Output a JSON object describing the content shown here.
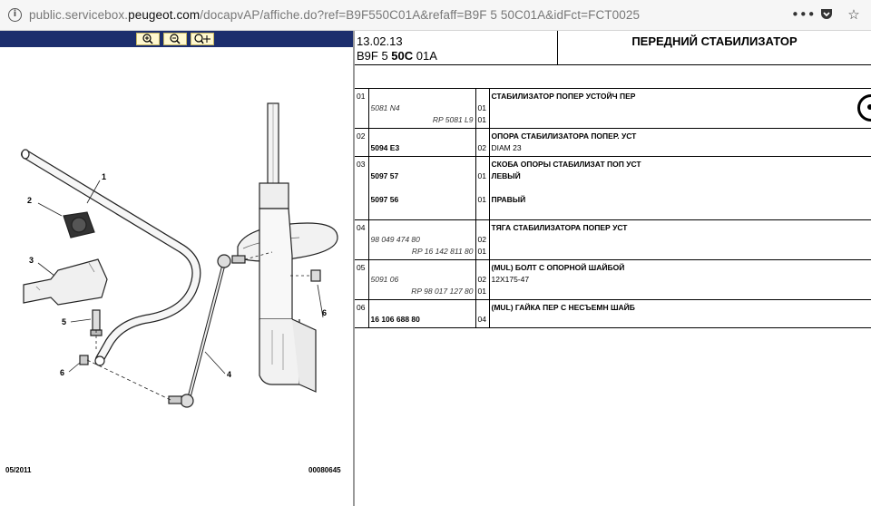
{
  "browser": {
    "url_prefix": "public.servicebox.",
    "url_domain": "peugeot.com",
    "url_suffix": "/docapvAP/affiche.do?ref=B9F550C01A&refaff=B9F 5 50C01A&idFct=FCT0025",
    "icons": [
      "info-icon",
      "more-icon",
      "pocket-icon",
      "star-icon"
    ]
  },
  "diagram": {
    "toolbar_buttons": [
      "zoom-in-icon",
      "zoom-out-icon",
      "zoom-pan-icon"
    ],
    "callouts": [
      "1",
      "2",
      "3",
      "4",
      "5",
      "6",
      "6"
    ],
    "footer_date": "05/2011",
    "footer_code": "00080645"
  },
  "header": {
    "date": "13.02.13",
    "code_prefix": "B9F 5 ",
    "code_bold": "50C",
    "code_suffix": " 01A",
    "title": "ПЕРЕДНИЙ СТАБИЛИЗАТОР"
  },
  "rows": [
    {
      "num": "01",
      "lines": [
        {
          "pn": "",
          "pn_style": "",
          "qty": "",
          "desc": "СТАБИЛИЗАТОР ПОПЕР УСТОЙЧ ПЕР",
          "desc_style": "b"
        },
        {
          "pn": "5081 N4",
          "pn_style": "it",
          "qty": "01",
          "desc": "",
          "desc_style": ""
        },
        {
          "pn": "RP 5081 L9",
          "pn_style": "it r",
          "qty": "01",
          "desc": "",
          "desc_style": ""
        }
      ]
    },
    {
      "num": "02",
      "lines": [
        {
          "pn": "",
          "pn_style": "",
          "qty": "",
          "desc": "ОПОРА СТАБИЛИЗАТОРА ПОПЕР. УСТ",
          "desc_style": "b"
        },
        {
          "pn": "5094 E3",
          "pn_style": "b",
          "qty": "02",
          "desc": "DIAM 23",
          "desc_style": ""
        }
      ]
    },
    {
      "num": "03",
      "lines": [
        {
          "pn": "",
          "pn_style": "",
          "qty": "",
          "desc": "СКОБА ОПОРЫ СТАБИЛИЗАТ ПОП УСТ",
          "desc_style": "b"
        },
        {
          "pn": "5097 57",
          "pn_style": "b",
          "qty": "01",
          "desc": "ЛЕВЫЙ",
          "desc_style": "b"
        },
        {
          "pn": "",
          "pn_style": "",
          "qty": "",
          "desc": "",
          "desc_style": ""
        },
        {
          "pn": "5097 56",
          "pn_style": "b",
          "qty": "01",
          "desc": "ПРАВЫЙ",
          "desc_style": "b"
        },
        {
          "pn": "",
          "pn_style": "",
          "qty": "",
          "desc": "",
          "desc_style": ""
        }
      ]
    },
    {
      "num": "04",
      "lines": [
        {
          "pn": "",
          "pn_style": "",
          "qty": "",
          "desc": "ТЯГА СТАБИЛИЗАТОРА ПОПЕР УСТ",
          "desc_style": "b"
        },
        {
          "pn": "98 049 474 80",
          "pn_style": "it",
          "qty": "02",
          "desc": "",
          "desc_style": ""
        },
        {
          "pn": "RP 16 142 811 80",
          "pn_style": "it r",
          "qty": "01",
          "desc": "",
          "desc_style": ""
        }
      ]
    },
    {
      "num": "05",
      "lines": [
        {
          "pn": "",
          "pn_style": "",
          "qty": "",
          "desc": "(MUL) БОЛТ С ОПОРНОЙ ШАЙБОЙ",
          "desc_style": "b"
        },
        {
          "pn": "5091 06",
          "pn_style": "it",
          "qty": "02",
          "desc": "12X175-47",
          "desc_style": ""
        },
        {
          "pn": "RP 98 017 127 80",
          "pn_style": "it r",
          "qty": "01",
          "desc": "",
          "desc_style": ""
        }
      ]
    },
    {
      "num": "06",
      "lines": [
        {
          "pn": "",
          "pn_style": "",
          "qty": "",
          "desc": "(MUL) ГАЙКА ПЕР С НЕСЪЕМН ШАЙБ",
          "desc_style": "b"
        },
        {
          "pn": "16 106 688 80",
          "pn_style": "b",
          "qty": "04",
          "desc": "",
          "desc_style": ""
        }
      ]
    }
  ]
}
